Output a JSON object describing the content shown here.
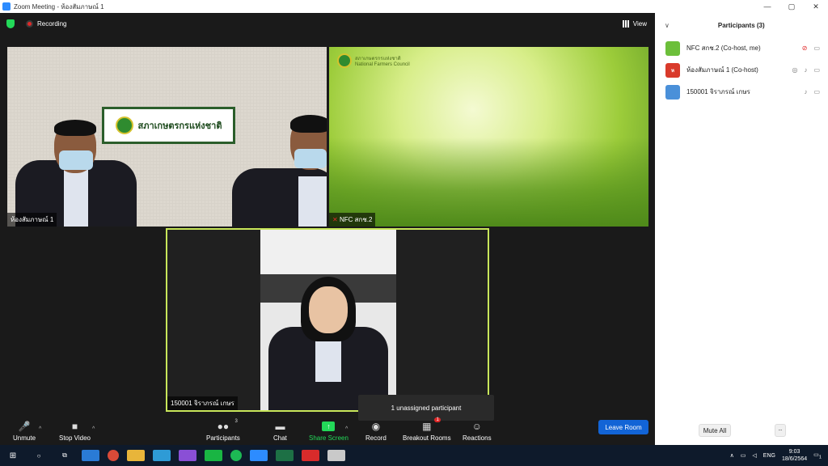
{
  "window": {
    "title": "Zoom Meeting - ห้องสัมภาษณ์ 1",
    "controls": [
      "—",
      "▢",
      "✕"
    ]
  },
  "topbar": {
    "recording_label": "Recording",
    "view_label": "View"
  },
  "tiles": [
    {
      "label": "ห้องสัมภาษณ์ 1",
      "sign_text": "สภาเกษตรกรแห่งชาติ"
    },
    {
      "label": "NFC สกช.2",
      "logo_th": "สภาเกษตรกรแห่งชาติ",
      "logo_en": "National Farmers Council"
    },
    {
      "label": "150001 จิราภรณ์ เกษร"
    }
  ],
  "tooltip": "1 unassigned participant",
  "toolbar": {
    "unmute": "Unmute",
    "stop_video": "Stop Video",
    "participants": "Participants",
    "participants_count": "3",
    "chat": "Chat",
    "share_screen": "Share Screen",
    "record": "Record",
    "breakout_rooms": "Breakout Rooms",
    "breakout_badge": "1",
    "reactions": "Reactions",
    "leave_room": "Leave Room"
  },
  "panel": {
    "title": "Participants (3)",
    "participants": [
      {
        "name": "NFC สกช.2 (Co-host, me)",
        "avatar_color": "#6cbf3a",
        "avatar_text": ""
      },
      {
        "name": "ห้องสัมภาษณ์ 1 (Co-host)",
        "avatar_color": "#d93a2b",
        "avatar_text": "ห"
      },
      {
        "name": "150001 จิราภรณ์ เกษร",
        "avatar_color": "#4a90d9",
        "avatar_text": ""
      }
    ],
    "mute_all": "Mute All",
    "more": ".."
  },
  "taskbar": {
    "lang": "ENG",
    "time": "9:03",
    "date": "18/6/2564",
    "notif": "1"
  }
}
